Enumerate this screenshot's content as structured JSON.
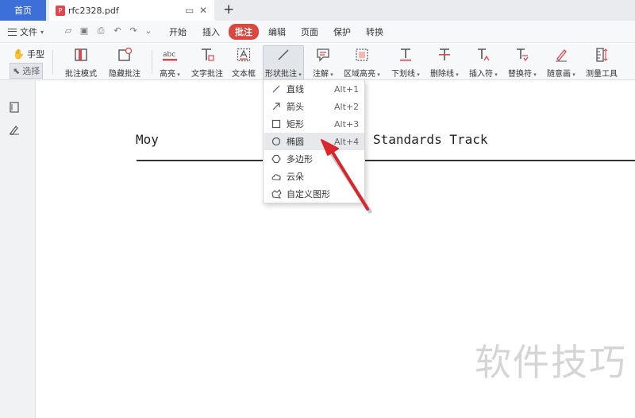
{
  "tabs": {
    "home": "首页",
    "document": "rfc2328.pdf",
    "new_tab": "+"
  },
  "menu": {
    "file": "文件",
    "items": [
      "开始",
      "插入",
      "批注",
      "编辑",
      "页面",
      "保护",
      "转换"
    ],
    "active": "批注"
  },
  "tools": {
    "hand": "手型",
    "select": "选择"
  },
  "ribbon": {
    "annotation_mode": "批注模式",
    "hide_annotation": "隐藏批注",
    "highlight": "高亮",
    "text_annotation": "文字批注",
    "text_box": "文本框",
    "shape_annotation": "形状批注",
    "note": "注解",
    "area_highlight": "区域高亮",
    "underline": "下划线",
    "strikethrough": "删除线",
    "insert_mark": "插入符",
    "replace_mark": "替换符",
    "freehand": "随意画",
    "measure": "测量工具",
    "highlight_icon_text": "abc"
  },
  "dropdown": {
    "items": [
      {
        "label": "直线",
        "shortcut": "Alt+1",
        "icon": "line-icon"
      },
      {
        "label": "箭头",
        "shortcut": "Alt+2",
        "icon": "arrow-icon"
      },
      {
        "label": "矩形",
        "shortcut": "Alt+3",
        "icon": "rectangle-icon"
      },
      {
        "label": "椭圆",
        "shortcut": "Alt+4",
        "icon": "ellipse-icon"
      },
      {
        "label": "多边形",
        "shortcut": "",
        "icon": "polygon-icon"
      },
      {
        "label": "云朵",
        "shortcut": "",
        "icon": "cloud-icon"
      },
      {
        "label": "自定义图形",
        "shortcut": "",
        "icon": "custom-shape-icon"
      }
    ],
    "highlighted": "椭圆"
  },
  "document": {
    "header_left": "Moy",
    "header_right": "Standards Track"
  },
  "watermark": "软件技巧",
  "colors": {
    "home_tab": "#3d6fd8",
    "active_menu": "#d9473e",
    "annotation_arrow": "#d9262c"
  }
}
